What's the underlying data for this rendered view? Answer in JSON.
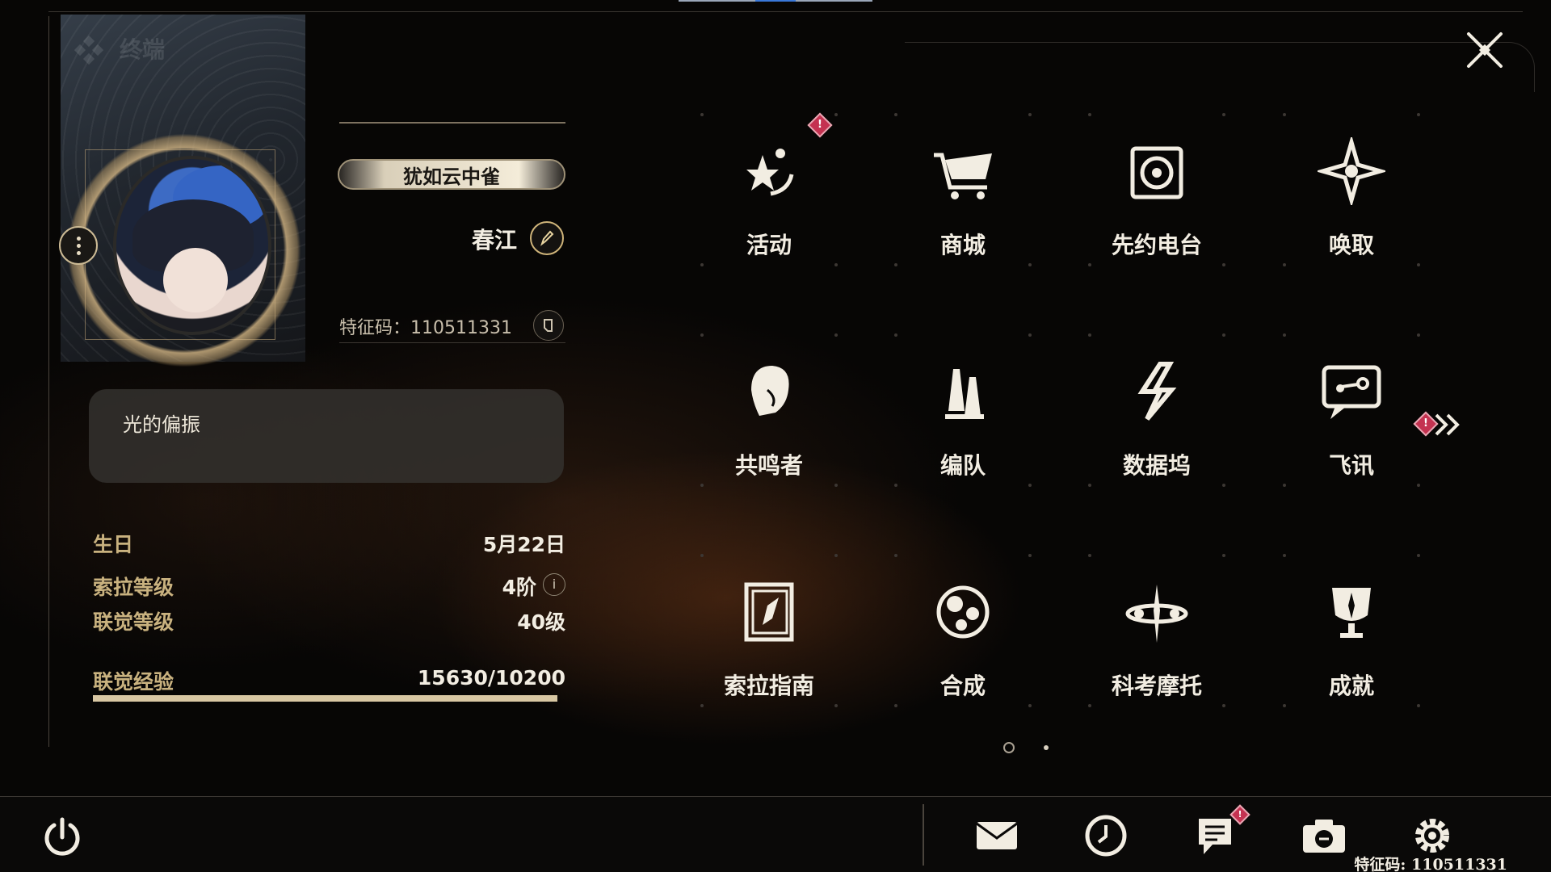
{
  "header": {
    "title": "终端",
    "close_icon": "close-x-icon"
  },
  "profile": {
    "title_badge": "犹如云中雀",
    "name": "春江",
    "uid_text": "特征码：110511331",
    "signature": "光的偏振",
    "stats": [
      {
        "key": "生日",
        "value": "5月22日"
      },
      {
        "key": "索拉等级",
        "value": "4阶"
      },
      {
        "key": "联觉等级",
        "value": "40级"
      },
      {
        "key": "联觉经验",
        "value": "15630/10200"
      }
    ],
    "exp_fill_fraction": 1.0,
    "info_glyph": "i"
  },
  "menu": {
    "items": [
      {
        "label": "活动",
        "icon": "event-stars-icon",
        "alert": true
      },
      {
        "label": "商城",
        "icon": "shopping-cart-icon",
        "alert": false
      },
      {
        "label": "先约电台",
        "icon": "radio-icon",
        "alert": false
      },
      {
        "label": "唤取",
        "icon": "compass-star-icon",
        "alert": false
      },
      {
        "label": "共鸣者",
        "icon": "resonator-head-icon",
        "alert": false
      },
      {
        "label": "编队",
        "icon": "chess-team-icon",
        "alert": false
      },
      {
        "label": "数据坞",
        "icon": "data-dock-icon",
        "alert": false
      },
      {
        "label": "飞讯",
        "icon": "message-bubble-icon",
        "alert": false
      },
      {
        "label": "索拉指南",
        "icon": "guide-book-icon",
        "alert": false
      },
      {
        "label": "合成",
        "icon": "synthesis-icon",
        "alert": false
      },
      {
        "label": "科考摩托",
        "icon": "motorcycle-icon",
        "alert": false
      },
      {
        "label": "成就",
        "icon": "trophy-icon",
        "alert": false
      }
    ],
    "alert_glyph": "!",
    "current_page": 1,
    "page_count": 2
  },
  "bottom_bar": {
    "buttons": [
      {
        "name": "mail",
        "icon": "mail-icon",
        "alert": false
      },
      {
        "name": "clock",
        "icon": "clock-icon",
        "alert": false
      },
      {
        "name": "notice",
        "icon": "notice-icon",
        "alert": true
      },
      {
        "name": "camera",
        "icon": "camera-icon",
        "alert": false
      },
      {
        "name": "settings",
        "icon": "gear-icon",
        "alert": false
      }
    ],
    "footer_uid": "特征码: 110511331"
  },
  "colors": {
    "accent_gold": "#c9b27f",
    "alert_red": "#c43251",
    "text_light": "#f2ede2",
    "background": "#070605"
  }
}
